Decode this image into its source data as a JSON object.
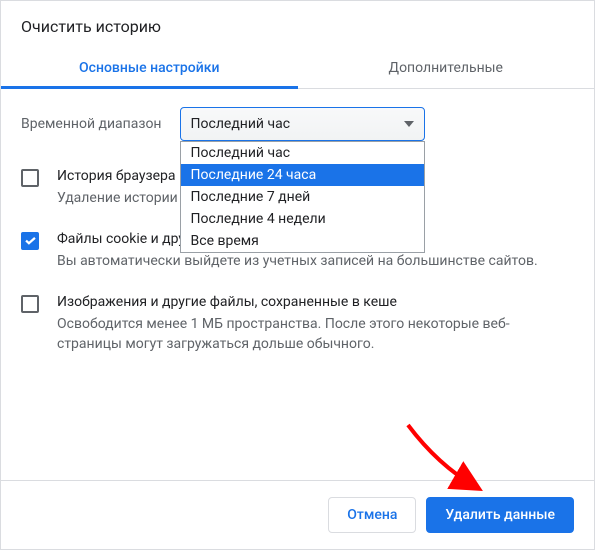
{
  "dialog": {
    "title": "Очистить историю"
  },
  "tabs": {
    "basic": "Основные настройки",
    "advanced": "Дополнительные"
  },
  "range": {
    "label": "Временной диапазон",
    "selected": "Последний час",
    "options": [
      "Последний час",
      "Последние 24 часа",
      "Последние 7 дней",
      "Последние 4 недели",
      "Все время"
    ],
    "highlighted_index": 1
  },
  "items": {
    "history": {
      "checked": false,
      "title": "История браузера",
      "desc": "Удаление истории                                                        адресной строке"
    },
    "cookies": {
      "checked": true,
      "title": "Файлы cookie и другие данные сайтов",
      "desc": "Вы автоматически выйдете из учетных записей на большинстве сайтов."
    },
    "cache": {
      "checked": false,
      "title": "Изображения и другие файлы, сохраненные в кеше",
      "desc": "Освободится менее 1 МБ пространства. После этого некоторые веб-страницы могут загружаться дольше обычного."
    }
  },
  "buttons": {
    "cancel": "Отмена",
    "clear": "Удалить данные"
  }
}
